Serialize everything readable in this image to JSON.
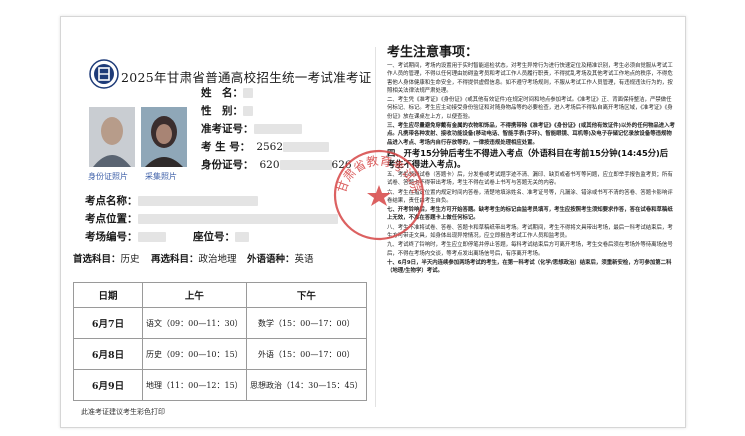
{
  "title": "2025年甘肃省普通高校招生统一考试准考证",
  "photos": [
    {
      "caption": "身份证照片"
    },
    {
      "caption": "采集照片"
    }
  ],
  "candidate": {
    "name_label": "姓　名：",
    "gender_label": "性　别：",
    "admission_label": "准考证号：",
    "exam_no_label": "考 生 号：",
    "exam_no_value": "2562",
    "id_label": "身份证号：",
    "id_value_prefix": "620",
    "id_value_suffix": "626"
  },
  "exam_site": {
    "site_name_label": "考点名称：",
    "site_location_label": "考点位置：",
    "room_label": "考场编号：",
    "seat_label": "座位号："
  },
  "subjects": {
    "first_label": "首选科目：",
    "first_value": "历史",
    "second_label": "再选科目：",
    "second_value": "政治地理",
    "language_label": "外语语种：",
    "language_value": "英语"
  },
  "schedule": {
    "headers": [
      "日期",
      "上午",
      "下午"
    ],
    "rows": [
      {
        "date": "6月7日",
        "am": "语文（09：00—11：30）",
        "pm": "数学（15：00—17：00）"
      },
      {
        "date": "6月8日",
        "am": "历史（09：00—10：15）",
        "pm": "外语（15：00—17：00）"
      },
      {
        "date": "6月9日",
        "am": "地理（11：00—12：15）",
        "pm": "思想政治（14：30—15：45）"
      }
    ]
  },
  "footnote": "此准考证建议考生彩色打印",
  "notes_title": "考生注意事项：",
  "notes": [
    {
      "text": "一、考试期间，考场内设置用于实时智能巡检状态，对考生异常行为进行快速定位及精准识别，考生必须自觉服从考试工作人员的管理，不得以任何理由妨碍监考员和考试工作人员履行职责，不得扰乱考场及其他考试工作地点的秩序，不得危害他人身体健康和生命安全，不得提供虚假信息。如不遵守考场规则，不服从考试工作人员管理，有违规违法行为的，按照相关法律法规严肃处理。",
      "style": "n"
    },
    {
      "text": "二、考生凭《准考证》《身份证》(或其他有效证件)在规定时间和地点参加考试。《准考证》正、背面保持整洁，严禁做任何标记、标记。考生应主动接受身份验证和对随身物品等的必要检查，进入考场后不得私自离开考场区域，《准考证》《身份证》放在课桌左上方，以便查验。",
      "style": "n"
    },
    {
      "text": "三、考生应尽量避免穿戴有金属的衣物和饰品，不得携带除《准考证》《身份证》(或其他有效证件)以外的任何物品进入考点。凡携带各种发射、接收功能设备(移动电话、智能手表(手环)、智能眼镜、耳机等)及电子存储记忆录放设备等违规物品进入考点、考场内自行存放等的，一律按违规处理相应处置。",
      "style": "em"
    },
    {
      "text": "四、开考15分钟后考生不得进入考点（外语科目在考前15分钟(14:45分)后考生不得进入考点)。",
      "style": "hl"
    },
    {
      "text": "五、考生领到试卷（答题卡）后，分发卷或考试题字迹不清、漏印、缺页或者书写等问题，应立即举手报告监考员；所有试卷、答题卡不得带出考场，考生不得在试卷上书写与答题无关的内容。",
      "style": "n"
    },
    {
      "text": "六、考生在指定位置内规定时间内答卷，清楚地填涂姓名、准考证号等，凡漏涂、错涂或书写不清的答卷、答题卡影响评卷结果，责任由考生自负。",
      "style": "n"
    },
    {
      "text": "七、开考铃响后，考生方可开始答题。缺考考生的标记由监考员填写，考生应按照考生须知要求作答，答在试卷和草稿纸上无效，不准在答题卡上做任何标记。",
      "style": "em"
    },
    {
      "text": "八、考生不准将试卷、答卷、答题卡和草稿纸带出考场。考试期间，考生不得将文具带出考场，最后一科考试结束后，考生方可带走文具，如身体出现异常情况，应立即报告考试工作人员和监考员。",
      "style": "n"
    },
    {
      "text": "九、考试终了铃响时，考生应立即停笔并停止答题，每科考试结束后方可离开考场，考生交卷后须在考场外等待离场信号后，不得在考场内交谈，等考点发出离场信号后，有序离开考场。",
      "style": "n"
    },
    {
      "text": "十、6月9日，半天内连续参加两场考试的考生，在第一科考试（化学/思想政治）结束后，须重新安检，方可参加第二科（地理/生物学）考试。",
      "style": "em"
    }
  ],
  "stamp_text": "甘肃省教育考试院",
  "colors": {
    "stamp": "#d64545",
    "caption": "#3d5fa8",
    "logo": "#1e3b78"
  }
}
